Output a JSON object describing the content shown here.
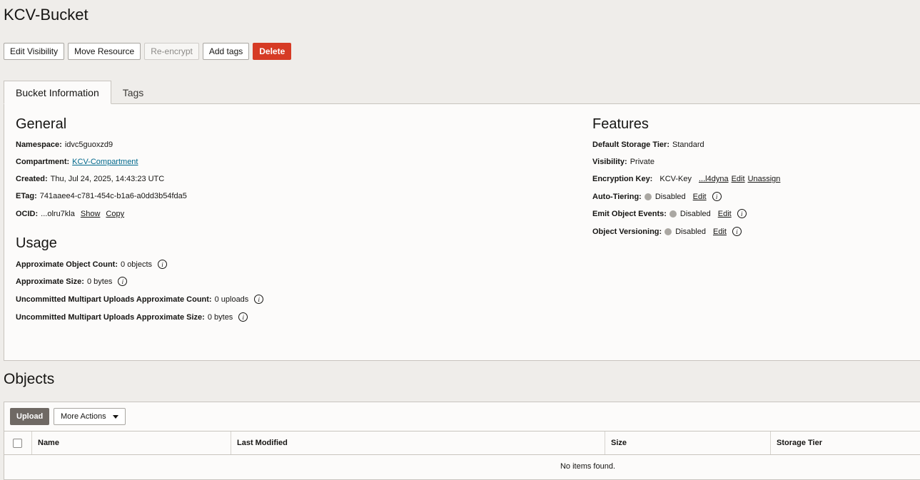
{
  "page": {
    "title": "KCV-Bucket"
  },
  "toolbar": {
    "edit_visibility": "Edit Visibility",
    "move_resource": "Move Resource",
    "reencrypt": "Re-encrypt",
    "add_tags": "Add tags",
    "delete": "Delete"
  },
  "tabs": {
    "bucket_info": "Bucket Information",
    "tags": "Tags"
  },
  "general": {
    "heading": "General",
    "namespace_label": "Namespace:",
    "namespace_value": "idvc5guoxzd9",
    "compartment_label": "Compartment:",
    "compartment_value": "KCV-Compartment",
    "created_label": "Created:",
    "created_value": "Thu, Jul 24, 2025, 14:43:23 UTC",
    "etag_label": "ETag:",
    "etag_value": "741aaee4-c781-454c-b1a6-a0dd3b54fda5",
    "ocid_label": "OCID:",
    "ocid_value": "...olru7kla",
    "show": "Show",
    "copy": "Copy"
  },
  "usage": {
    "heading": "Usage",
    "object_count_label": "Approximate Object Count:",
    "object_count_value": "0 objects",
    "size_label": "Approximate Size:",
    "size_value": "0 bytes",
    "multipart_count_label": "Uncommitted Multipart Uploads Approximate Count:",
    "multipart_count_value": "0 uploads",
    "multipart_size_label": "Uncommitted Multipart Uploads Approximate Size:",
    "multipart_size_value": "0 bytes"
  },
  "features": {
    "heading": "Features",
    "storage_tier_label": "Default Storage Tier:",
    "storage_tier_value": "Standard",
    "visibility_label": "Visibility:",
    "visibility_value": "Private",
    "encryption_label": "Encryption Key:",
    "encryption_value": "KCV-Key",
    "encryption_key_id": "...l4dyna",
    "edit": "Edit",
    "unassign": "Unassign",
    "auto_tiering_label": "Auto-Tiering:",
    "auto_tiering_value": "Disabled",
    "emit_events_label": "Emit Object Events:",
    "emit_events_value": "Disabled",
    "versioning_label": "Object Versioning:",
    "versioning_value": "Disabled",
    "status_color": "#aaa7a2"
  },
  "objects": {
    "title": "Objects",
    "upload": "Upload",
    "more_actions": "More Actions",
    "columns": [
      "Name",
      "Last Modified",
      "Size",
      "Storage Tier"
    ],
    "empty_message": "No items found."
  },
  "colors": {
    "danger": "#d63b25",
    "link": "#00688c",
    "upload_bg": "#6f6964"
  }
}
